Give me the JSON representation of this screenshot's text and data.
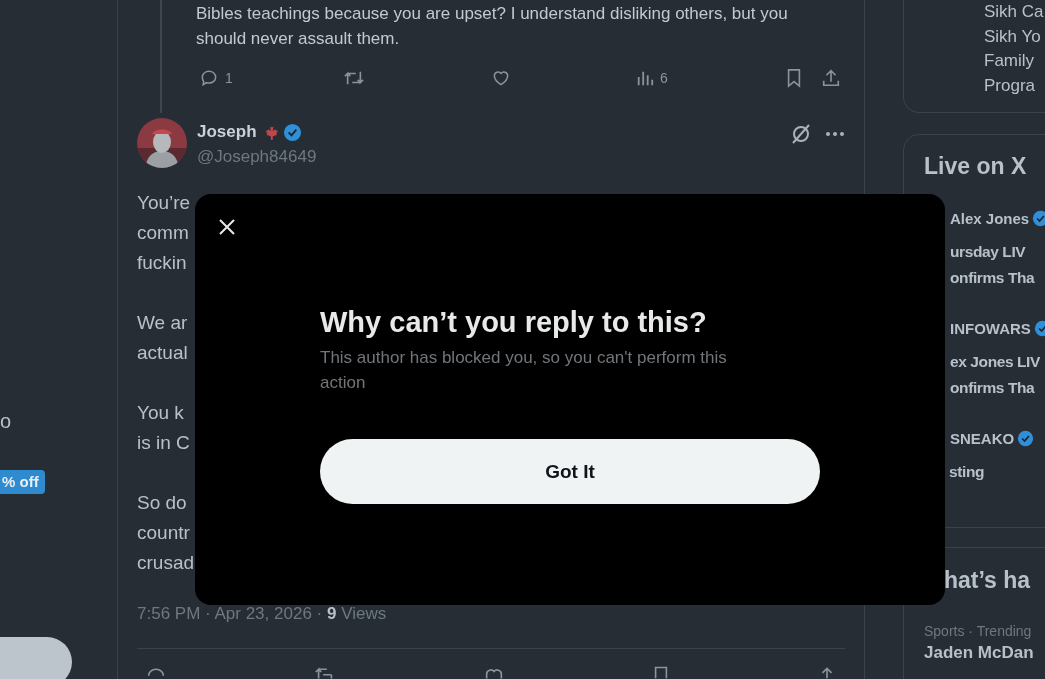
{
  "left_nav": {
    "fragment": "o",
    "badge": "% off"
  },
  "thread_reply": {
    "text_lines": [
      "Bibles teachings because you are upset? I understand disliking others, but you",
      "should never assault them."
    ],
    "actions": {
      "replies": "1",
      "views": "6"
    }
  },
  "tweet": {
    "name": "Joseph",
    "flag": true,
    "verified": true,
    "handle": "@Joseph84649",
    "paragraphs": [
      [
        "You’re",
        "comm",
        "fuckin"
      ],
      [
        "We ar",
        "actual"
      ],
      [
        "You k",
        "is in C"
      ],
      [
        "So do",
        "countr",
        "crusad"
      ]
    ],
    "timestamp": "7:56 PM · Apr 23, 2026 · **9** Views"
  },
  "sidebar": {
    "card_lines": [
      "Sikh Ca",
      "Sikh Yo",
      "Family",
      "Progra"
    ],
    "live": {
      "title": "Live on X",
      "items": [
        {
          "host": "Alex Jones",
          "verified": true,
          "title_lines": [
            "ursday LIV",
            "onfirms Tha"
          ]
        },
        {
          "host": "INFOWARS",
          "verified": true,
          "title_lines": [
            "ex Jones LIV",
            "onfirms Tha"
          ]
        },
        {
          "host": "SNEAKO",
          "verified": true,
          "title_lines": [
            "sting"
          ]
        }
      ]
    },
    "trends": {
      "title": "hat’s ha",
      "items": [
        {
          "context": "Sports · Trending",
          "name": "Jaden McDan"
        }
      ]
    }
  },
  "dialog": {
    "title": "Why can’t you reply to this?",
    "message": "This author has blocked you, so you can't perform this action",
    "button": "Got It"
  }
}
